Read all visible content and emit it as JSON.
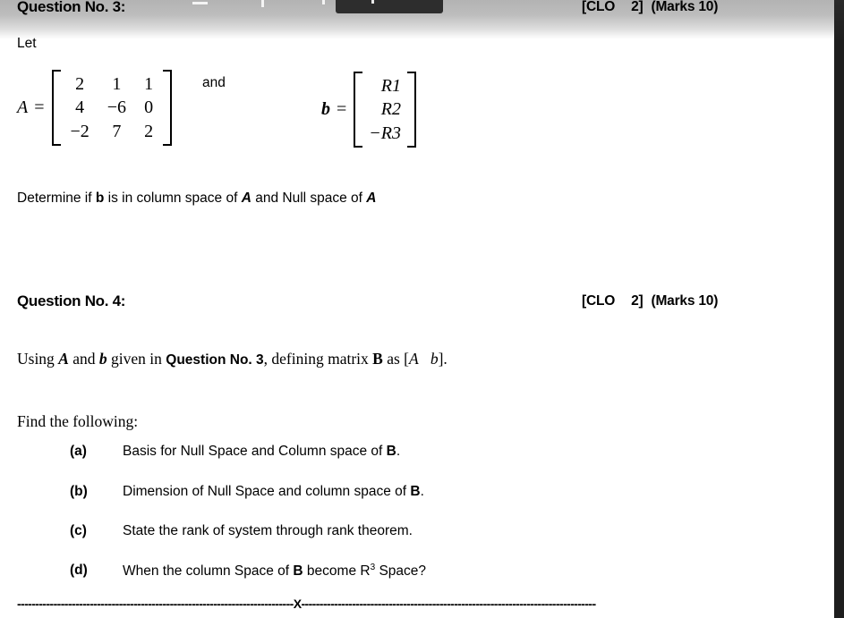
{
  "document": {
    "questions": [
      {
        "heading": "Question No. 3:",
        "clo_prefix": "[CLO",
        "clo_number": "2]",
        "marks": "(Marks 10)",
        "lead_in": "Let",
        "conjunction": "and",
        "matrix_a": {
          "label": "A",
          "equals": "=",
          "rows": [
            [
              "2",
              "1",
              "1"
            ],
            [
              "4",
              "−6",
              "0"
            ],
            [
              "−2",
              "7",
              "2"
            ]
          ]
        },
        "vector_b": {
          "label": "b",
          "equals": "=",
          "rows": [
            [
              "R1"
            ],
            [
              "R2"
            ],
            [
              "−R3"
            ]
          ]
        },
        "prompt": "Determine if b is in column space of A and Null space of A",
        "prompt_parts": {
          "p1": "Determine if ",
          "b1": "b",
          "p2": " is in column space of ",
          "b2": "A",
          "p3": " and Null space of ",
          "b3": "A"
        }
      },
      {
        "heading": "Question No. 4:",
        "clo_prefix": "[CLO",
        "clo_number": "2]",
        "marks": "(Marks 10)",
        "intro_parts": {
          "t1": "Using ",
          "a": "A",
          "t2": " and ",
          "b": "b",
          "t3": " given in ",
          "ref": "Question No. 3",
          "t4": ", defining matrix ",
          "bmat": "B",
          "t5": " as [",
          "ia": "A",
          "t6": "   ",
          "ib": "b",
          "t7": "]."
        },
        "find_label": "Find the following:",
        "items": [
          {
            "marker": "(a)",
            "text_pre": "Basis for Null Space and Column space of ",
            "bold": "B",
            "text_post": "."
          },
          {
            "marker": "(b)",
            "text_pre": "Dimension of Null Space and column space of ",
            "bold": "B",
            "text_post": "."
          },
          {
            "marker": "(c)",
            "text_pre": "State the rank of system through rank theorem.",
            "bold": "",
            "text_post": ""
          },
          {
            "marker": "(d)",
            "text_pre": "When the column Space of ",
            "bold": "B",
            "text_post": " become R",
            "sup": "3",
            "text_end": " Space?"
          }
        ]
      }
    ],
    "footer": {
      "divider_left": "----------------------------------------------------------------------------",
      "divider_mark": "X",
      "divider_right": "---------------------------------------------------------------------------------"
    }
  },
  "colors": {
    "page_background": "#ffffff",
    "text": "#000000",
    "top_band": "#b3b3b3",
    "toolbar_fragment": "#2d2d2d",
    "right_panel": "#1e1e1e"
  }
}
